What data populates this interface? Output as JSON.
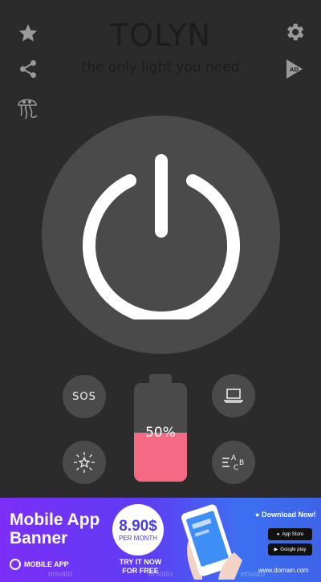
{
  "app": {
    "title": "TOLYN",
    "subtitle": "the only light you need",
    "battery_level": 0.5,
    "battery_label": "50%",
    "sos_label": "SOS",
    "colors": {
      "background": "#2b2b2b",
      "button": "#4a4a4a",
      "battery_fill": "#f46a84",
      "icon": "#9a9a9a"
    },
    "icons": {
      "top_left": [
        "star-icon",
        "share-icon",
        "jellyfish-icon"
      ],
      "top_right": [
        "gear-icon",
        "ad-play-icon"
      ],
      "bottom": [
        "sos",
        "laptop-icon",
        "strobe-star-icon",
        "text-light-icon"
      ]
    }
  },
  "ad": {
    "title": "Mobile App Banner",
    "brand": "MOBILE APP",
    "price_value": "8.90$",
    "price_unit": "PER MONTH",
    "cta": "TRY IT NOW FOR FREE",
    "download": "Download Now!",
    "app_store": "App Store",
    "google_play": "Google play",
    "url": "www.domain.com",
    "watermark": "envato"
  }
}
